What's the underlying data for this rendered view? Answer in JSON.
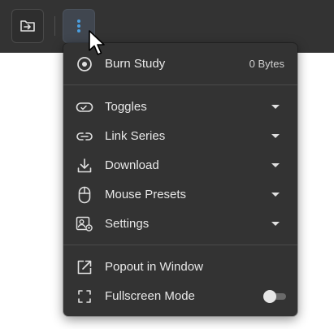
{
  "toolbar": {
    "folder_icon": "folder-import-icon",
    "more_icon": "more-vertical-icon",
    "accent": "#4a9fe0"
  },
  "menu": {
    "burn": {
      "label": "Burn Study",
      "value": "0 Bytes",
      "icon": "disc-icon"
    },
    "items": [
      {
        "label": "Toggles",
        "icon": "toggle-icon"
      },
      {
        "label": "Link Series",
        "icon": "link-icon"
      },
      {
        "label": "Download",
        "icon": "download-icon"
      },
      {
        "label": "Mouse Presets",
        "icon": "mouse-icon"
      },
      {
        "label": "Settings",
        "icon": "settings-icon"
      }
    ],
    "popout": {
      "label": "Popout in Window",
      "icon": "popout-icon"
    },
    "fullscreen": {
      "label": "Fullscreen Mode",
      "icon": "fullscreen-icon",
      "enabled": false
    }
  }
}
